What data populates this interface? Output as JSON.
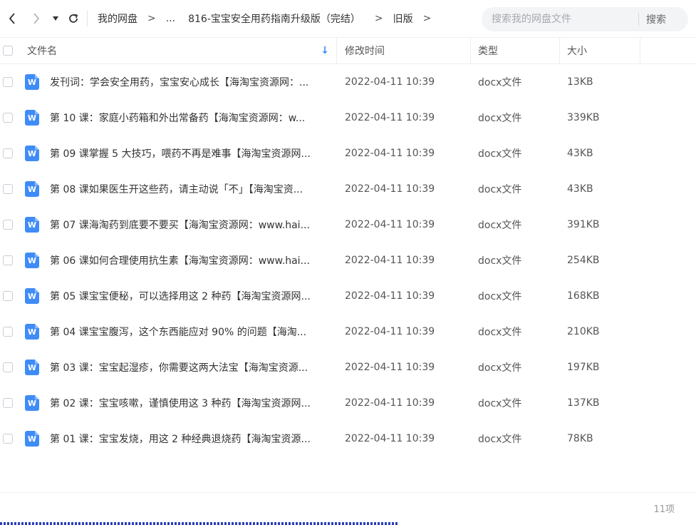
{
  "toolbar": {
    "breadcrumb": [
      "我的网盘",
      "...",
      "816-宝宝安全用药指南升级版（完结）",
      "旧版"
    ],
    "separator": ">",
    "search_placeholder": "搜索我的网盘文件",
    "search_button": "搜索"
  },
  "table": {
    "headers": {
      "name": "文件名",
      "time": "修改时间",
      "type": "类型",
      "size": "大小"
    },
    "rows": [
      {
        "name": "发刊词：学会安全用药，宝宝安心成长【海淘宝资源网：...",
        "time": "2022-04-11 10:39",
        "type": "docx文件",
        "size": "13KB"
      },
      {
        "name": "第 10 课：家庭小药箱和外出常备药【海淘宝资源网：w...",
        "time": "2022-04-11 10:39",
        "type": "docx文件",
        "size": "339KB"
      },
      {
        "name": "第 09 课掌握 5 大技巧，喂药不再是难事【海淘宝资源网...",
        "time": "2022-04-11 10:39",
        "type": "docx文件",
        "size": "43KB"
      },
      {
        "name": "第 08 课如果医生开这些药，请主动说「不」【海淘宝资...",
        "time": "2022-04-11 10:39",
        "type": "docx文件",
        "size": "43KB"
      },
      {
        "name": "第 07 课海淘药到底要不要买【海淘宝资源网：www.hai...",
        "time": "2022-04-11 10:39",
        "type": "docx文件",
        "size": "391KB"
      },
      {
        "name": "第 06 课如何合理使用抗生素【海淘宝资源网：www.hai...",
        "time": "2022-04-11 10:39",
        "type": "docx文件",
        "size": "254KB"
      },
      {
        "name": "第 05 课宝宝便秘，可以选择用这 2 种药【海淘宝资源网...",
        "time": "2022-04-11 10:39",
        "type": "docx文件",
        "size": "168KB"
      },
      {
        "name": "第 04 课宝宝腹泻，这个东西能应对 90% 的问题【海淘...",
        "time": "2022-04-11 10:39",
        "type": "docx文件",
        "size": "210KB"
      },
      {
        "name": "第 03 课：宝宝起湿疹，你需要这两大法宝【海淘宝资源...",
        "time": "2022-04-11 10:39",
        "type": "docx文件",
        "size": "197KB"
      },
      {
        "name": "第 02 课：宝宝咳嗽，谨慎使用这 3 种药【海淘宝资源网...",
        "time": "2022-04-11 10:39",
        "type": "docx文件",
        "size": "137KB"
      },
      {
        "name": "第 01 课：宝宝发烧，用这 2 种经典退烧药【海淘宝资源...",
        "time": "2022-04-11 10:39",
        "type": "docx文件",
        "size": "78KB"
      }
    ]
  },
  "footer": {
    "count": "11项"
  },
  "icons": {
    "file_icon_letter": "W",
    "accent_color": "#3f8cf7"
  }
}
